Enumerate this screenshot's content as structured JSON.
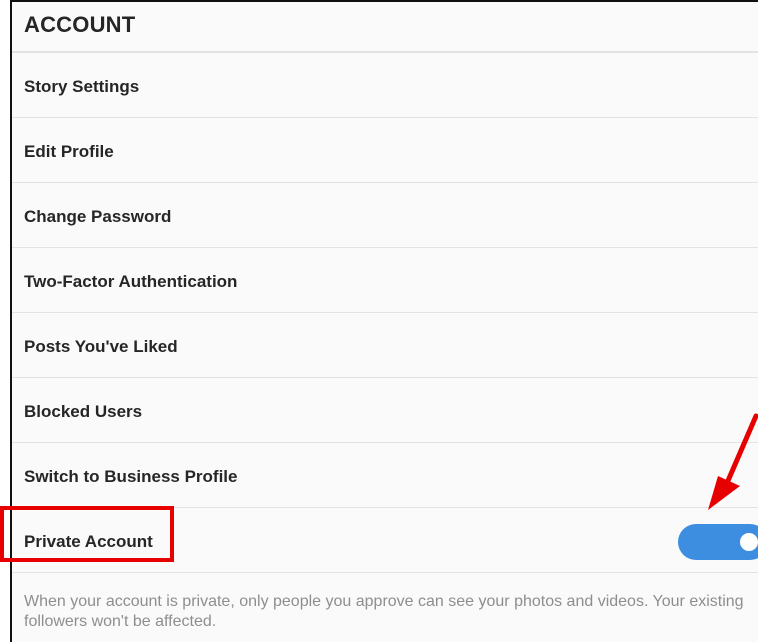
{
  "header": {
    "title": "ACCOUNT"
  },
  "rows": [
    {
      "label": "Story Settings"
    },
    {
      "label": "Edit Profile"
    },
    {
      "label": "Change Password"
    },
    {
      "label": "Two-Factor Authentication"
    },
    {
      "label": "Posts You've Liked"
    },
    {
      "label": "Blocked Users"
    },
    {
      "label": "Switch to Business Profile"
    },
    {
      "label": "Private Account",
      "toggle_on": true
    }
  ],
  "private_description": "When your account is private, only people you approve can see your photos and videos. Your existing followers won't be affected.",
  "colors": {
    "toggle_on": "#3d8ee0",
    "annotation": "#e60000",
    "text_primary": "#262626",
    "text_secondary": "#8e8e8e"
  }
}
